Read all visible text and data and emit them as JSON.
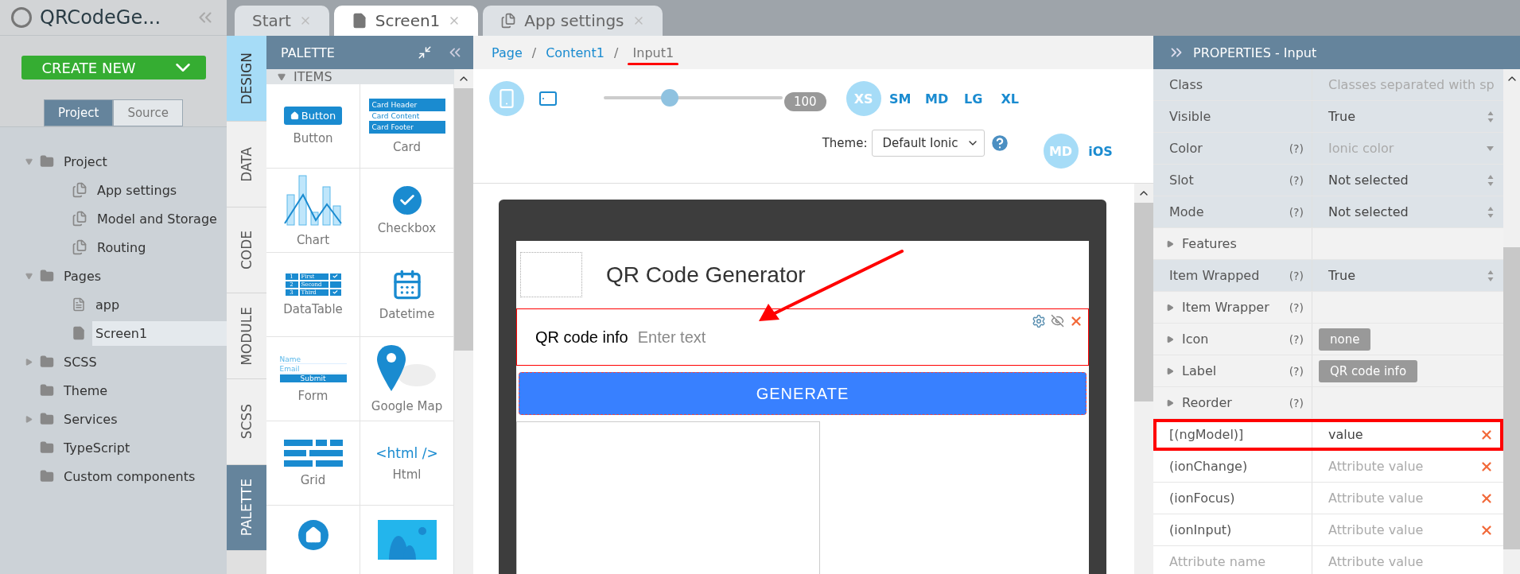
{
  "sidebar": {
    "title": "QRCodeGe...",
    "create_button": "CREATE NEW",
    "view_toggle": [
      {
        "label": "Project",
        "selected": true
      },
      {
        "label": "Source",
        "selected": false
      }
    ],
    "tree": [
      {
        "label": "Project",
        "kind": "folder",
        "expanded": true,
        "children": [
          {
            "label": "App settings",
            "kind": "settings",
            "selected": false
          },
          {
            "label": "Model and Storage",
            "kind": "settings",
            "selected": false
          },
          {
            "label": "Routing",
            "kind": "settings",
            "selected": false
          }
        ]
      },
      {
        "label": "Pages",
        "kind": "folder",
        "expanded": true,
        "children": [
          {
            "label": "app",
            "kind": "page-outline",
            "selected": false
          },
          {
            "label": "Screen1",
            "kind": "page",
            "selected": true
          }
        ]
      },
      {
        "label": "SCSS",
        "kind": "folder",
        "expanded": false
      },
      {
        "label": "Theme",
        "kind": "folder"
      },
      {
        "label": "Services",
        "kind": "folder",
        "expanded": false
      },
      {
        "label": "TypeScript",
        "kind": "folder"
      },
      {
        "label": "Custom components",
        "kind": "folder"
      }
    ]
  },
  "editor_tabs": [
    {
      "label": "Start",
      "kind": "plain",
      "selected": false
    },
    {
      "label": "Screen1",
      "kind": "page",
      "selected": true
    },
    {
      "label": "App settings",
      "kind": "settings",
      "selected": false
    }
  ],
  "side_tabs": [
    {
      "label": "DESIGN",
      "selected": true,
      "open": false
    },
    {
      "label": "DATA",
      "selected": false,
      "open": false
    },
    {
      "label": "CODE",
      "selected": false,
      "open": false
    },
    {
      "label": "MODULE",
      "selected": false,
      "open": false
    },
    {
      "label": "SCSS",
      "selected": false,
      "open": false
    },
    {
      "label": "PALETTE",
      "selected": false,
      "open": true
    }
  ],
  "palette": {
    "title": "PALETTE",
    "section": "ITEMS",
    "section_expanded": true,
    "items": [
      {
        "kind": "button",
        "label": "Button",
        "preview": [
          "Button"
        ]
      },
      {
        "kind": "card",
        "label": "Card",
        "preview": [
          "Card Header",
          "Card Content",
          "Card Footer"
        ]
      },
      {
        "kind": "chart",
        "label": "Chart"
      },
      {
        "kind": "checkbox",
        "label": "Checkbox"
      },
      {
        "kind": "datatable",
        "label": "DataTable",
        "preview": [
          "1",
          "First",
          "2",
          "Second",
          "3",
          "Third"
        ]
      },
      {
        "kind": "datetime",
        "label": "Datetime"
      },
      {
        "kind": "form",
        "label": "Form",
        "preview": [
          "Name",
          "Email",
          "Submit"
        ]
      },
      {
        "kind": "map",
        "label": "Google Map"
      },
      {
        "kind": "grid",
        "label": "Grid"
      },
      {
        "kind": "html",
        "label": "Html",
        "preview": [
          "<html />"
        ]
      },
      {
        "kind": "home"
      },
      {
        "kind": "image"
      }
    ]
  },
  "breadcrumb": [
    {
      "label": "Page",
      "current": false
    },
    {
      "separator": "/",
      "label": "Content1",
      "current": false
    },
    {
      "separator": "/",
      "label": "Input1",
      "current": true
    }
  ],
  "toolbar": {
    "devices": [
      {
        "kind": "phone",
        "selected": true
      },
      {
        "kind": "tablet",
        "selected": false
      }
    ],
    "zoom": {
      "level": 0.37,
      "reading": "100"
    },
    "sizes": [
      {
        "label": "XS",
        "selected": true
      },
      {
        "label": "SM",
        "selected": false
      },
      {
        "label": "MD",
        "selected": false
      },
      {
        "label": "LG",
        "selected": false
      },
      {
        "label": "XL",
        "selected": false
      }
    ],
    "theme_label": "Theme:",
    "theme_value": "Default Ionic",
    "modes": [
      {
        "label": "MD",
        "selected": true
      },
      {
        "label": "iOS",
        "selected": false
      }
    ]
  },
  "screen": {
    "title": "QR Code Generator",
    "input_label": "QR code info",
    "input_placeholder": "Enter text",
    "input_selected": true,
    "button": "GENERATE"
  },
  "properties": {
    "title": "PROPERTIES - Input",
    "rows": [
      {
        "kind": "text",
        "name": "Class",
        "placeholder": "Classes separated with sp"
      },
      {
        "kind": "select",
        "name": "Visible",
        "value": "True"
      },
      {
        "kind": "dropdown",
        "name": "Color",
        "help": "(?)",
        "placeholder": "Ionic color"
      },
      {
        "kind": "select",
        "name": "Slot",
        "help": "(?)",
        "value": "Not selected"
      },
      {
        "kind": "select",
        "name": "Mode",
        "help": "(?)",
        "value": "Not selected"
      },
      {
        "kind": "group",
        "name": "Features"
      },
      {
        "kind": "select",
        "name": "Item Wrapped",
        "help": "(?)",
        "value": "True"
      },
      {
        "kind": "group",
        "name": "Item Wrapper",
        "help": "(?)"
      },
      {
        "kind": "group",
        "name": "Icon",
        "help": "(?)",
        "chip": "none"
      },
      {
        "kind": "group",
        "name": "Label",
        "help": "(?)",
        "chip": "QR code info"
      },
      {
        "kind": "group",
        "name": "Reorder",
        "help": "(?)"
      },
      {
        "kind": "attribute",
        "name": "[(ngModel)]",
        "value": "value",
        "highlighted": true
      },
      {
        "kind": "attribute",
        "name": "(ionChange)",
        "placeholder": "Attribute value",
        "highlighted": false
      },
      {
        "kind": "attribute",
        "name": "(ionFocus)",
        "placeholder": "Attribute value",
        "highlighted": false
      },
      {
        "kind": "attribute",
        "name": "(ionInput)",
        "placeholder": "Attribute value",
        "highlighted": false
      },
      {
        "kind": "new",
        "name_placeholder": "Attribute name",
        "placeholder": "Attribute value"
      }
    ]
  }
}
